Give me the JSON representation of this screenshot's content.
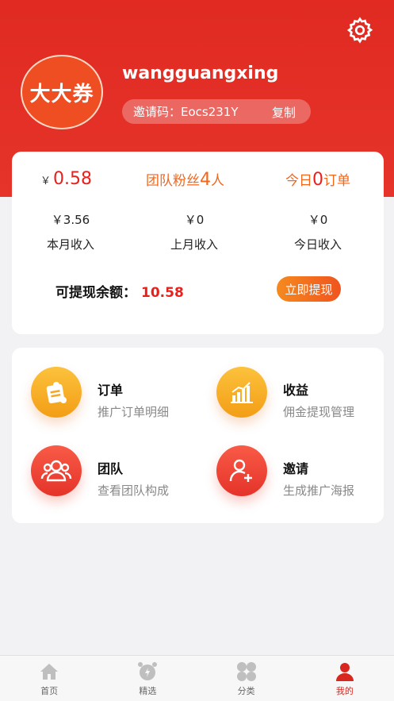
{
  "user": {
    "avatar_text": "大大券",
    "username": "wangguangxing"
  },
  "invite": {
    "label": "邀请码：Eocs231Y",
    "copy_label": "复制"
  },
  "stats": {
    "balance_yen": "￥",
    "balance": "0.58",
    "fans_prefix": "团队粉丝",
    "fans_count": "4",
    "fans_suffix": "人",
    "orders_prefix": "今日",
    "orders_count": "0",
    "orders_suffix": "订单"
  },
  "income": [
    {
      "value": "￥3.56",
      "label": "本月收入"
    },
    {
      "value": "￥0",
      "label": "上月收入"
    },
    {
      "value": "￥0",
      "label": "今日收入"
    }
  ],
  "withdraw": {
    "label": "可提现余额：",
    "value": "10.58",
    "button": "立即提现"
  },
  "menu": [
    {
      "title": "订单",
      "subtitle": "推广订单明细",
      "icon": "order-icon"
    },
    {
      "title": "收益",
      "subtitle": "佣金提现管理",
      "icon": "earnings-chart-icon"
    },
    {
      "title": "团队",
      "subtitle": "查看团队构成",
      "icon": "team-icon"
    },
    {
      "title": "邀请",
      "subtitle": "生成推广海报",
      "icon": "add-user-icon"
    }
  ],
  "tabs": [
    {
      "label": "首页",
      "icon": "home-icon"
    },
    {
      "label": "精选",
      "icon": "alarm-clock-icon"
    },
    {
      "label": "分类",
      "icon": "category-icon"
    },
    {
      "label": "我的",
      "icon": "user-icon",
      "active": true
    }
  ],
  "colors": {
    "brand_red": "#e02a22",
    "accent_orange": "#f1671b",
    "value_red": "#e8211c",
    "icon_yellow": "#fcc23c"
  }
}
